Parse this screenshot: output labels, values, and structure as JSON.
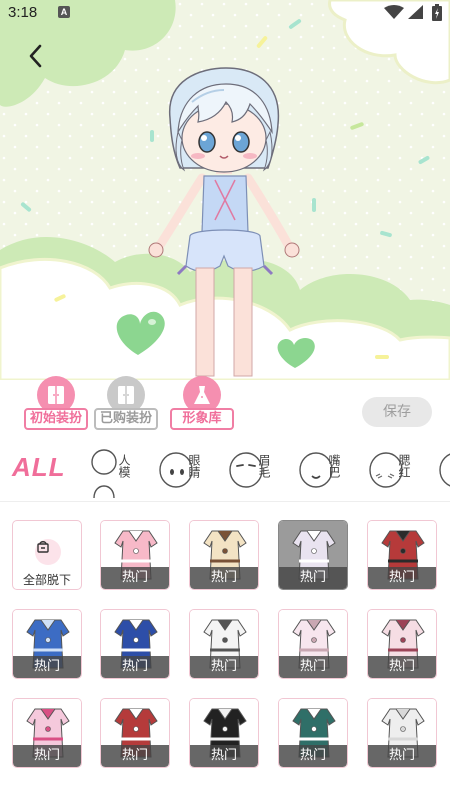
{
  "status_bar": {
    "time": "3:18",
    "notification": "A"
  },
  "category_buttons": [
    {
      "label": "初始装扮",
      "icon": "wardrobe-icon",
      "state": "active"
    },
    {
      "label": "已购装扮",
      "icon": "wardrobe-icon",
      "state": "inactive"
    },
    {
      "label": "形象库",
      "icon": "dress-icon",
      "state": "active"
    }
  ],
  "save_label": "保存",
  "tabs": {
    "all_label": "ALL",
    "items": [
      {
        "label": "人模",
        "icon": "body-icon"
      },
      {
        "label": "眼睛",
        "icon": "eyes-icon"
      },
      {
        "label": "眉毛",
        "icon": "eyebrow-icon"
      },
      {
        "label": "嘴巴",
        "icon": "mouth-icon"
      },
      {
        "label": "腮红",
        "icon": "blush-icon"
      }
    ]
  },
  "grid": {
    "undress_label": "全部脱下",
    "hot_label": "热门",
    "items": [
      {
        "id": "outfit-1",
        "palette": [
          "#f7b9c8",
          "#ffffff"
        ]
      },
      {
        "id": "outfit-2",
        "palette": [
          "#f3e3c4",
          "#7a5236"
        ]
      },
      {
        "id": "outfit-3",
        "palette": [
          "#e9e3f0",
          "#ffffff"
        ],
        "selected": true
      },
      {
        "id": "outfit-4",
        "palette": [
          "#b63a3a",
          "#2b2b2b"
        ]
      },
      {
        "id": "outfit-5",
        "palette": [
          "#3c6cc4",
          "#cfe0f7"
        ]
      },
      {
        "id": "outfit-6",
        "palette": [
          "#2d4ea8",
          "#ffffff"
        ]
      },
      {
        "id": "outfit-7",
        "palette": [
          "#f4f4f4",
          "#555555"
        ]
      },
      {
        "id": "outfit-8",
        "palette": [
          "#f7e6ee",
          "#c9a7b2"
        ]
      },
      {
        "id": "outfit-9",
        "palette": [
          "#f6dde4",
          "#9c4357"
        ]
      },
      {
        "id": "outfit-10",
        "palette": [
          "#f5c9dc",
          "#d94f84"
        ]
      },
      {
        "id": "outfit-11",
        "palette": [
          "#b53b3b",
          "#ffffff"
        ]
      },
      {
        "id": "outfit-12",
        "palette": [
          "#222222",
          "#f2f2f2"
        ]
      },
      {
        "id": "outfit-13",
        "palette": [
          "#2f6f68",
          "#ffffff"
        ]
      },
      {
        "id": "outfit-14",
        "palette": [
          "#eeeeee",
          "#d8d8d8"
        ]
      }
    ]
  },
  "colors": {
    "accent_pink": "#f06e9a",
    "scene_bg": "#f1f5e4",
    "cloud_green": "#cdeab6",
    "hot_overlay": "#464646"
  }
}
